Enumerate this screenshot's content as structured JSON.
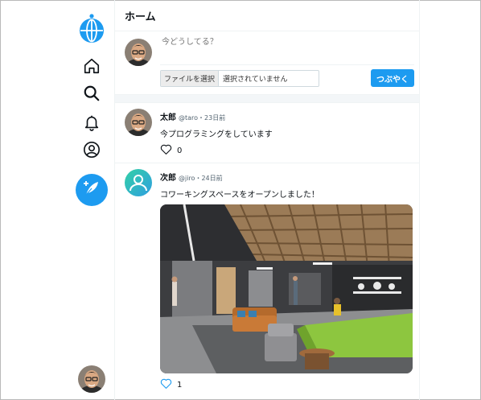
{
  "app": {
    "logo_icon": "globe-icon",
    "accent": "#1d9bf0"
  },
  "sidebar": {
    "items": [
      {
        "name": "home",
        "icon": "home-icon"
      },
      {
        "name": "search",
        "icon": "search-icon"
      },
      {
        "name": "notifications",
        "icon": "bell-icon"
      },
      {
        "name": "profile",
        "icon": "user-icon"
      }
    ],
    "compose_icon": "feather-plus-icon"
  },
  "header": {
    "title": "ホーム"
  },
  "composer": {
    "placeholder": "今どうしてる？",
    "file_button_label": "ファイルを選択",
    "file_status": "選択されていません",
    "submit_label": "つぶやく"
  },
  "posts": [
    {
      "name": "太郎",
      "handle": "@taro",
      "dot": "・",
      "time": "23日前",
      "text": "今プログラミングをしています",
      "likes": "0",
      "liked": false
    },
    {
      "name": "次郎",
      "handle": "@jiro",
      "dot": "・",
      "time": "24日前",
      "text": "コワーキングスペースをオープンしました！",
      "likes": "1",
      "liked": false,
      "has_image": true
    }
  ]
}
